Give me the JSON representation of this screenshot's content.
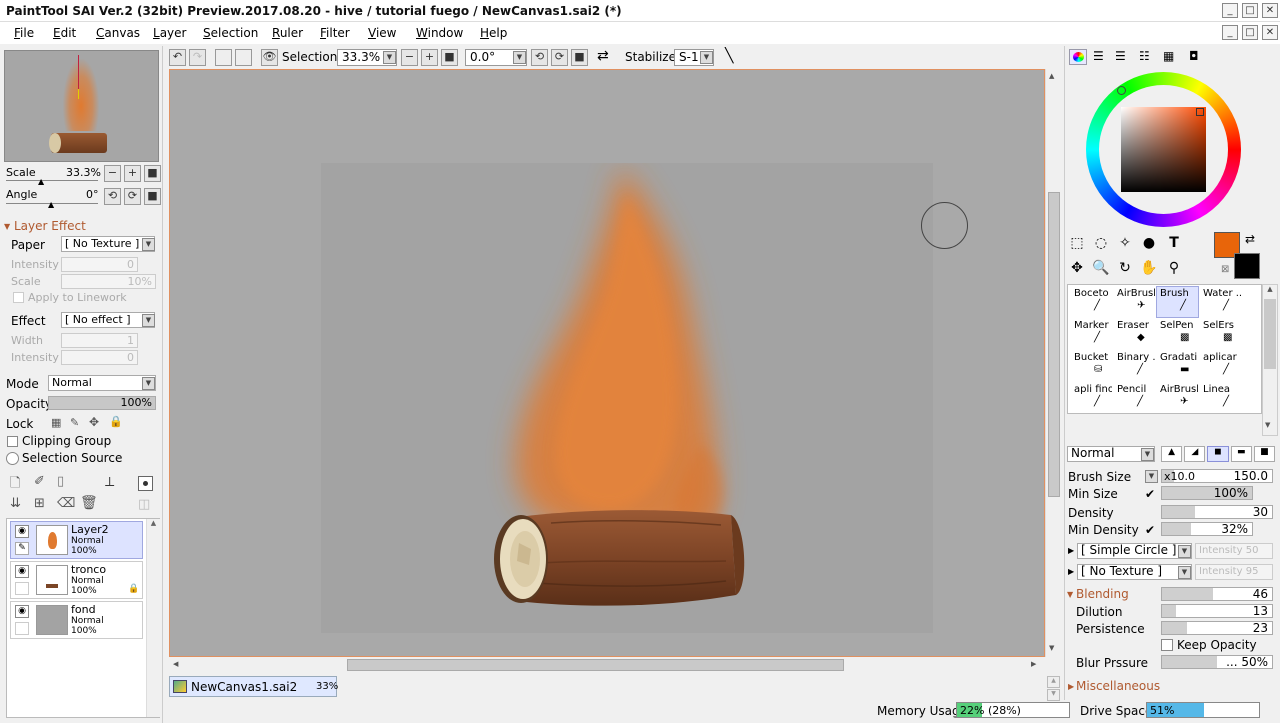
{
  "window": {
    "title": "PaintTool SAI Ver.2 (32bit) Preview.2017.08.20 - hive / tutorial fuego / NewCanvas1.sai2 (*)"
  },
  "menu": [
    "File",
    "Edit",
    "Canvas",
    "Layer",
    "Selection",
    "Ruler",
    "Filter",
    "View",
    "Window",
    "Help"
  ],
  "toolbar": {
    "selection_label": "Selection",
    "zoom": "33.3%",
    "angle": "0.0°",
    "stabilizer_label": "Stabilizer",
    "stabilizer": "S-1"
  },
  "navigator": {
    "scale_label": "Scale",
    "scale": "33.3%",
    "angle_label": "Angle",
    "angle": "0°"
  },
  "layer_effect": {
    "header": "Layer Effect",
    "paper_label": "Paper",
    "paper_value": "[ No Texture ]",
    "intensity_label": "Intensity",
    "intensity_value": "0",
    "scale_label": "Scale",
    "scale_value": "10%",
    "apply_linework": "Apply to Linework",
    "effect_label": "Effect",
    "effect_value": "[ No effect ]",
    "width_label": "Width",
    "width_value": "1",
    "intensity2_label": "Intensity",
    "intensity2_value": "0"
  },
  "layer_props": {
    "mode_label": "Mode",
    "mode_value": "Normal",
    "opacity_label": "Opacity",
    "opacity_value": "100%",
    "opacity_fraction": 1.0,
    "lock_label": "Lock",
    "clipping_group": "Clipping Group",
    "selection_source": "Selection Source"
  },
  "layers": [
    {
      "name": "Layer2",
      "mode": "Normal",
      "opacity": "100%",
      "selected": true
    },
    {
      "name": "tronco",
      "mode": "Normal",
      "opacity": "100%",
      "selected": false
    },
    {
      "name": "fond",
      "mode": "Normal",
      "opacity": "100%",
      "selected": false
    }
  ],
  "doc_tab": {
    "name": "NewCanvas1.sai2",
    "zoom": "33%"
  },
  "status": {
    "memory_label": "Memory Usage",
    "memory_value": "22% (28%)",
    "memory_fraction": 0.22,
    "drive_label": "Drive Space",
    "drive_value": "51%",
    "drive_fraction": 0.51
  },
  "colors": {
    "primary": "#e8650a",
    "secondary": "#000000",
    "accent": "#4b5bd6",
    "canvas_border": "#e09060"
  },
  "brushes": [
    {
      "name": "Boceto",
      "icon": "pen-icon"
    },
    {
      "name": "AirBrush",
      "icon": "airbrush-icon"
    },
    {
      "name": "Brush",
      "icon": "brush-icon",
      "selected": true
    },
    {
      "name": "Water ...",
      "icon": "water-icon"
    },
    {
      "name": "Marker",
      "icon": "marker-icon"
    },
    {
      "name": "Eraser",
      "icon": "eraser-icon"
    },
    {
      "name": "SelPen",
      "icon": "selpen-icon"
    },
    {
      "name": "SelErs",
      "icon": "selers-icon"
    },
    {
      "name": "Bucket",
      "icon": "bucket-icon"
    },
    {
      "name": "Binary ...",
      "icon": "pen-icon"
    },
    {
      "name": "Gradati...",
      "icon": "gradient-icon"
    },
    {
      "name": "aplicar ...",
      "icon": "pen-icon"
    },
    {
      "name": "apli fino",
      "icon": "pen-icon"
    },
    {
      "name": "Pencil",
      "icon": "pencil-icon"
    },
    {
      "name": "AirBrush",
      "icon": "airbrush-icon"
    },
    {
      "name": "Linea",
      "icon": "pen-icon"
    }
  ],
  "brush_settings": {
    "blend_mode": "Normal",
    "brush_size_label": "Brush Size",
    "brush_size_mult": "x10.0",
    "brush_size": "150.0",
    "min_size_label": "Min Size",
    "min_size": "100%",
    "min_size_fraction": 1.0,
    "density_label": "Density",
    "density": "30",
    "density_fraction": 0.3,
    "min_density_label": "Min Density",
    "min_density": "32%",
    "min_density_fraction": 0.32,
    "shape": "[ Simple Circle ]",
    "shape_intensity": "Intensity 50",
    "texture": "[ No Texture ]",
    "texture_intensity": "Intensity 95",
    "blending_label": "Blending",
    "blending": "46",
    "blending_fraction": 0.46,
    "dilution_label": "Dilution",
    "dilution": "13",
    "dilution_fraction": 0.13,
    "persistence_label": "Persistence",
    "persistence": "23",
    "persistence_fraction": 0.23,
    "keep_opacity": "Keep Opacity",
    "blur_label": "Blur Prssure",
    "blur": "... 50%",
    "blur_fraction": 0.5,
    "misc_label": "Miscellaneous"
  }
}
